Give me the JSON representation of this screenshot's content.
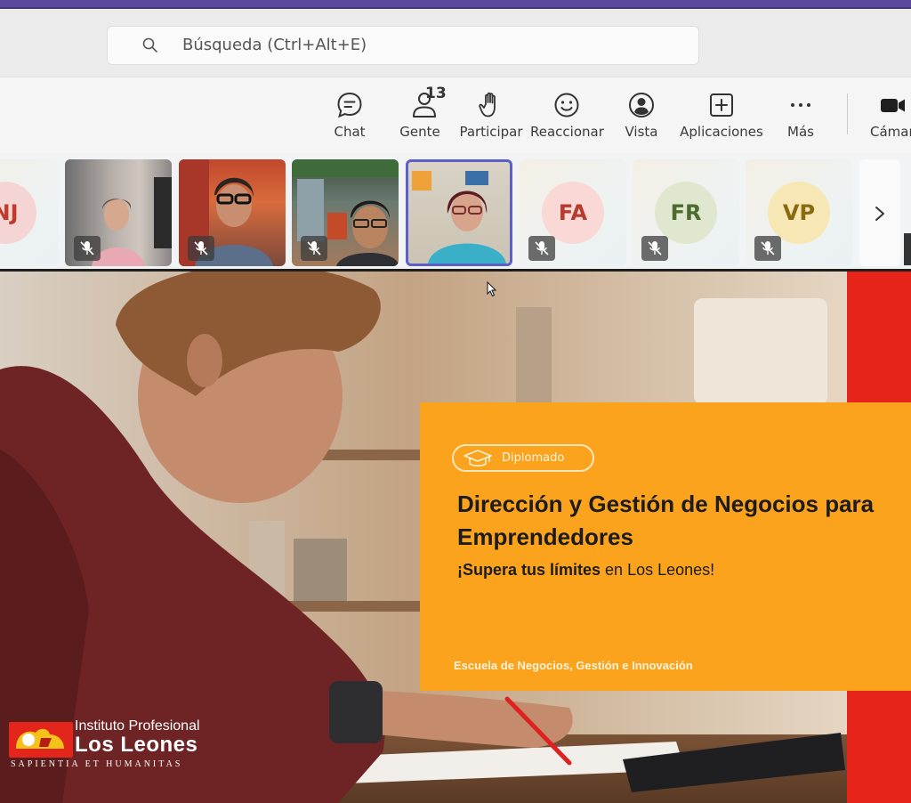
{
  "search": {
    "placeholder": "Búsqueda (Ctrl+Alt+E)"
  },
  "toolbar": {
    "items": [
      {
        "label": "Chat",
        "icon": "chat-icon"
      },
      {
        "label": "Gente",
        "icon": "people-icon",
        "count": "13"
      },
      {
        "label": "Participar",
        "icon": "raise-hand-icon"
      },
      {
        "label": "Reaccionar",
        "icon": "smile-icon"
      },
      {
        "label": "Vista",
        "icon": "view-icon"
      },
      {
        "label": "Aplicaciones",
        "icon": "plus-square-icon"
      },
      {
        "label": "Más",
        "icon": "more-icon"
      },
      {
        "label": "Cámar",
        "icon": "camera-icon"
      }
    ]
  },
  "participants": [
    {
      "initials": "NJ",
      "muted": true,
      "type": "avatar"
    },
    {
      "type": "video",
      "muted": true
    },
    {
      "type": "video",
      "muted": true
    },
    {
      "type": "video",
      "muted": true
    },
    {
      "type": "video",
      "muted": false,
      "active": true
    },
    {
      "initials": "FA",
      "muted": true,
      "type": "avatar"
    },
    {
      "initials": "FR",
      "muted": true,
      "type": "avatar"
    },
    {
      "initials": "VP",
      "muted": true,
      "type": "avatar"
    }
  ],
  "slide": {
    "badge": "Diplomado",
    "title": "Dirección y Gestión de Negocios para Emprendedores",
    "subtitle_bold": "¡Supera tus límites",
    "subtitle_rest": " en Los Leones!",
    "footer": "Escuela de Negocios, Gestión e Innovación",
    "logo": {
      "line1": "Instituto Profesional",
      "line2": "Los Leones",
      "line3": "SAPIENTIA ET HUMANITAS"
    }
  },
  "colors": {
    "accent": "#5b5fc7",
    "title_bar": "#5b4a9c",
    "card_orange": "#fba31d",
    "band_red": "#e62419"
  }
}
